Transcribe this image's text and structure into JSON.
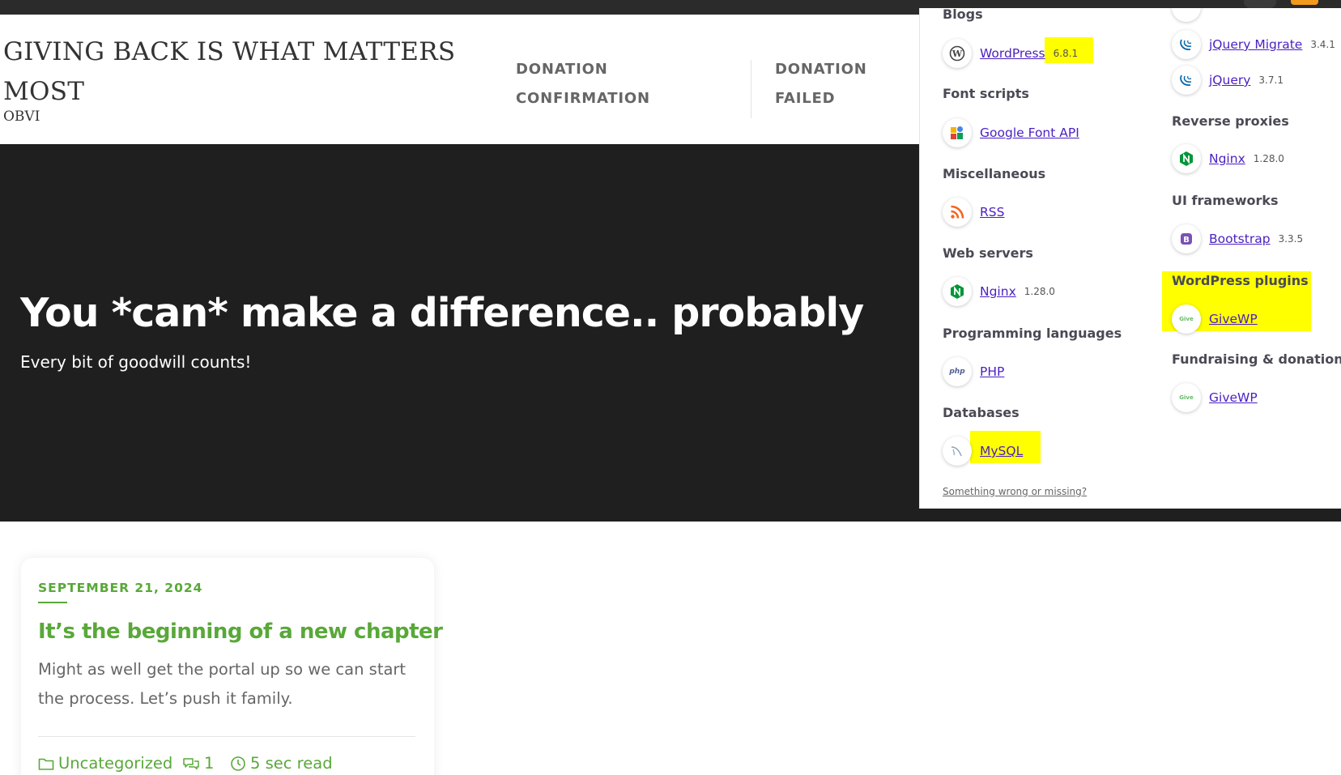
{
  "site": {
    "title": "GIVING BACK IS WHAT MATTERS MOST",
    "tagline": "OBVI",
    "nav": [
      {
        "label": "DONATION CONFIRMATION"
      },
      {
        "label": "DONATION FAILED"
      }
    ]
  },
  "hero": {
    "title": "You *can* make a difference.. probably",
    "subtitle": "Every bit of goodwill counts!"
  },
  "wappalyzer": {
    "highlight_color": "#ffff00",
    "link_color": "#4b1fc2",
    "left": {
      "blogs": {
        "title": "Blogs",
        "items": [
          {
            "name": "WordPress",
            "version": "6.8.1",
            "icon": "wordpress-icon"
          }
        ]
      },
      "font_scripts": {
        "title": "Font scripts",
        "items": [
          {
            "name": "Google Font API",
            "icon": "google-font-api-icon"
          }
        ]
      },
      "misc": {
        "title": "Miscellaneous",
        "items": [
          {
            "name": "RSS",
            "icon": "rss-icon"
          }
        ]
      },
      "web_servers": {
        "title": "Web servers",
        "items": [
          {
            "name": "Nginx",
            "version": "1.28.0",
            "icon": "nginx-icon"
          }
        ]
      },
      "languages": {
        "title": "Programming languages",
        "items": [
          {
            "name": "PHP",
            "icon": "php-icon"
          }
        ]
      },
      "databases": {
        "title": "Databases",
        "items": [
          {
            "name": "MySQL",
            "icon": "mysql-icon"
          }
        ]
      }
    },
    "right": {
      "js_libraries": {
        "items": [
          {
            "name": "jQuery Migrate",
            "version": "3.4.1",
            "icon": "jquery-icon"
          },
          {
            "name": "jQuery",
            "version": "3.7.1",
            "icon": "jquery-icon"
          }
        ]
      },
      "reverse_proxies": {
        "title": "Reverse proxies",
        "items": [
          {
            "name": "Nginx",
            "version": "1.28.0",
            "icon": "nginx-icon"
          }
        ]
      },
      "ui_frameworks": {
        "title": "UI frameworks",
        "items": [
          {
            "name": "Bootstrap",
            "version": "3.3.5",
            "icon": "bootstrap-icon"
          }
        ]
      },
      "wp_plugins": {
        "title": "WordPress plugins",
        "items": [
          {
            "name": "GiveWP",
            "icon": "givewp-icon"
          }
        ]
      },
      "fundraising": {
        "title": "Fundraising & donations",
        "items": [
          {
            "name": "GiveWP",
            "icon": "givewp-icon"
          }
        ]
      }
    },
    "feedback_link": "Something wrong or missing?",
    "givewp_icon_text": "Give",
    "php_icon_text": "php"
  },
  "post": {
    "date": "SEPTEMBER 21, 2024",
    "title": "It’s the beginning of a new chapter",
    "excerpt": "Might as well get the portal up so we can start the process. Let’s push it family.",
    "category": "Uncategorized",
    "comments": "1",
    "read_time": "5 sec read",
    "accent_color": "#59a839"
  }
}
